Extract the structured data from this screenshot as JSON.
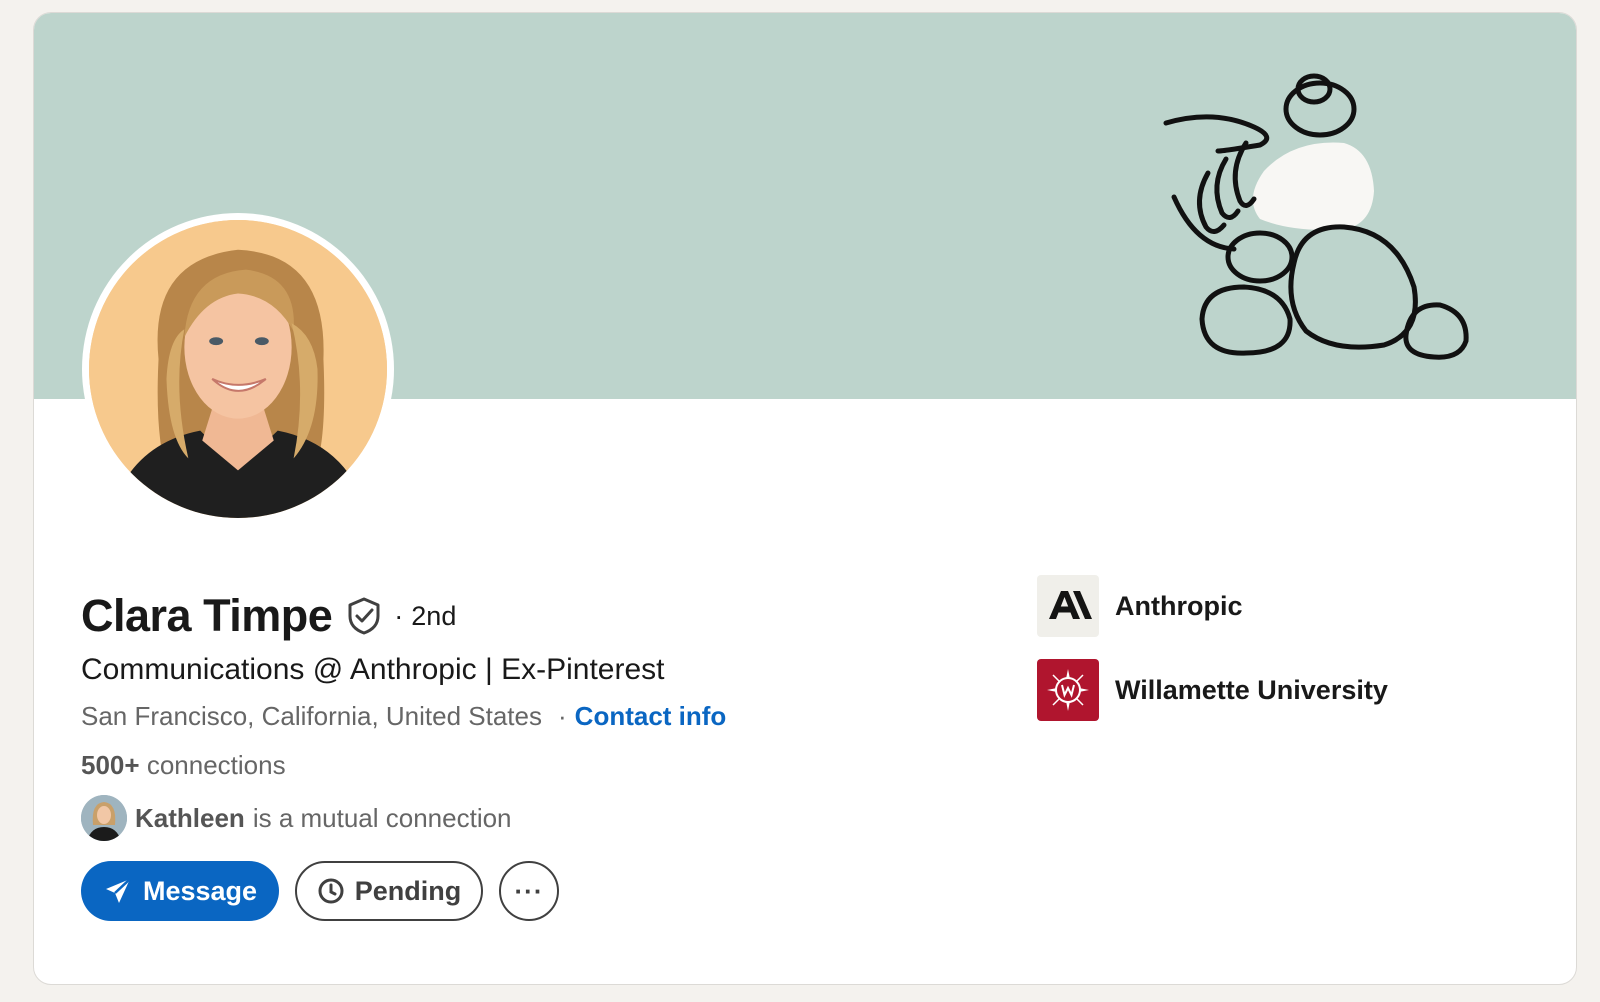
{
  "profile": {
    "name": "Clara Timpe",
    "degree": "2nd",
    "degree_separator": "·",
    "headline": "Communications @ Anthropic | Ex-Pinterest",
    "location": "San Francisco, California, United States",
    "contact_separator": "·",
    "contact_label": "Contact info",
    "connections_count": "500+",
    "connections_label": "connections",
    "mutual": {
      "name": "Kathleen",
      "text": "is a mutual connection"
    }
  },
  "actions": {
    "message_label": "Message",
    "pending_label": "Pending",
    "more_label": "···"
  },
  "organizations": [
    {
      "name": "Anthropic",
      "logo": "anthropic-logo"
    },
    {
      "name": "Willamette University",
      "logo": "willamette-logo"
    }
  ],
  "colors": {
    "banner": "#bdd4cc",
    "primary": "#0a66c2",
    "avatar_bg": "#f7c98d",
    "willamette": "#b0152e"
  },
  "icons": {
    "verified": "shield-check-icon",
    "message": "paper-plane-icon",
    "pending": "clock-icon",
    "more": "ellipsis-icon"
  }
}
